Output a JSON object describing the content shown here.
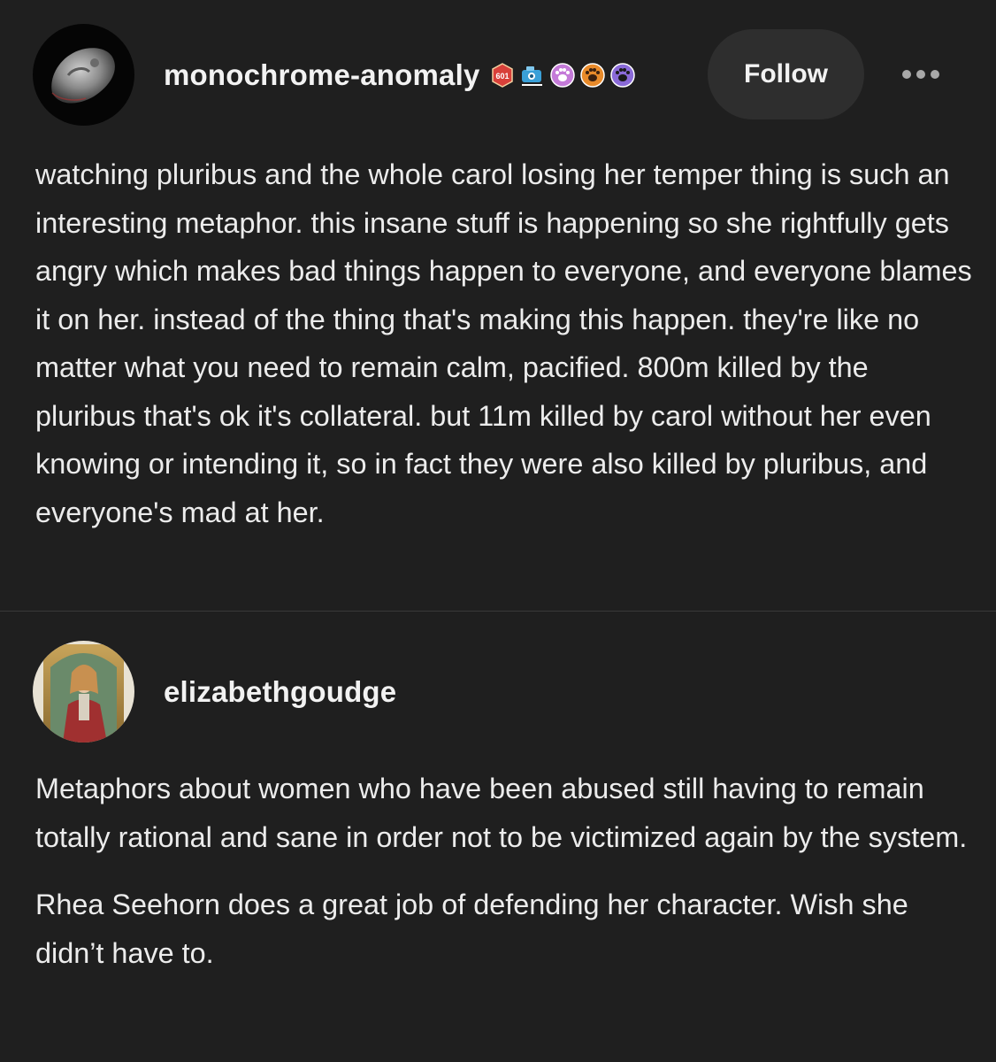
{
  "posts": [
    {
      "username": "monochrome-anomaly",
      "avatar": "asteroid-avatar",
      "badges": [
        {
          "name": "ribbon-badge-icon",
          "text": "601",
          "color": "#d8403a"
        },
        {
          "name": "camera-badge-icon",
          "color": "#3aa0d8"
        },
        {
          "name": "paw-badge-icon",
          "color": "#c47ad8"
        },
        {
          "name": "paw-badge-icon",
          "color": "#e88a2a"
        },
        {
          "name": "paw-badge-icon",
          "color": "#8a6ad8"
        }
      ],
      "follow_label": "Follow",
      "paragraphs": [
        "watching pluribus and the whole carol losing her temper thing is such an interesting metaphor. this insane stuff is happening so she rightfully gets angry which makes bad things happen to everyone, and everyone blames it on her. instead of the thing that's making this happen. they're like no matter what you need to remain calm, pacified. 800m killed by the pluribus that's ok it's collateral. but 11m killed by carol without her even knowing or intending it, so in fact they were also killed by pluribus, and everyone's mad at her."
      ]
    },
    {
      "username": "elizabethgoudge",
      "avatar": "portrait-avatar",
      "paragraphs": [
        "Metaphors about women who have been abused still having to remain totally rational and sane in order not to be victimized again by the system.",
        "Rhea Seehorn does a great job of defending her character. Wish she didn’t have to."
      ]
    }
  ],
  "colors": {
    "background": "#1f1f1f",
    "text": "#ececec",
    "follow_button_bg": "#2e2e2e",
    "divider": "#3a3a3a"
  }
}
